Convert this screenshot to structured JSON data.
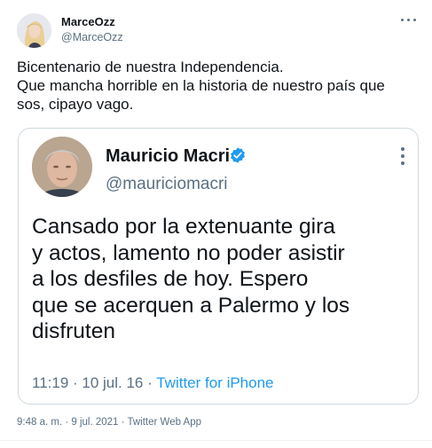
{
  "tweet": {
    "author_name": "MarceOzz",
    "author_handle": "@MarceOzz",
    "text_lines": [
      "Bicentenario de nuestra Independencia.",
      "Que mancha horrible en la historia de nuestro país que",
      "sos, cipayo vago."
    ],
    "timestamp": "9:48 a. m. · 9 jul. 2021",
    "separator": "·",
    "source": "Twitter Web App"
  },
  "quoted": {
    "author_name": "Mauricio Macri",
    "author_handle": "@mauriciomacri",
    "verified": true,
    "text_lines": [
      "Cansado por la extenuante gira",
      "y actos, lamento no poder asistir",
      "a los desfiles de hoy. Espero",
      "que se acerquen a Palermo y los",
      "disfruten"
    ],
    "timestamp": "11:19 · 10 jul. 16",
    "separator": "·",
    "source": "Twitter for iPhone"
  },
  "colors": {
    "text": "#0f1419",
    "secondary": "#5b7083",
    "accent": "#1d9bf0",
    "border": "#cfd9de"
  },
  "icons": [
    "more-horizontal-icon",
    "verified-badge-icon",
    "more-vertical-icon"
  ]
}
